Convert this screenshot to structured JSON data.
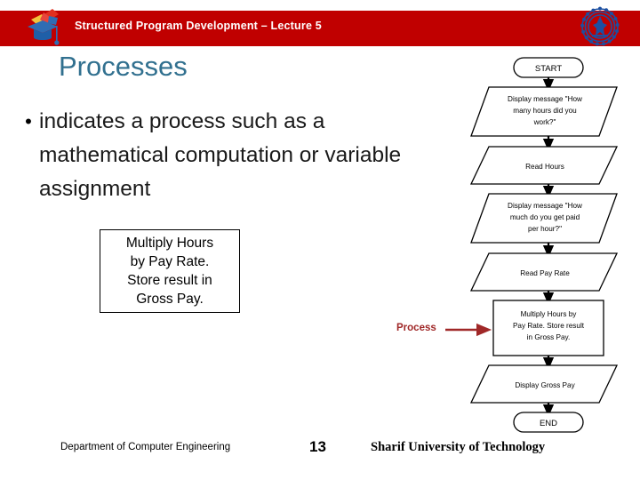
{
  "header": {
    "title": "Structured Program Development – Lecture 5",
    "bar_color": "#C00000",
    "left_logo_name": "graduation-cap-logo",
    "right_logo_name": "sharif-university-seal"
  },
  "slide": {
    "title": "Processes",
    "title_color": "#31708F",
    "bullets": [
      "indicates a process such as a mathematical computation or variable assignment"
    ],
    "example_box_text": "Multiply Hours\nby Pay Rate.\nStore result in\nGross Pay."
  },
  "callout": {
    "label": "Process",
    "color": "#A02828"
  },
  "flowchart": {
    "nodes": [
      {
        "id": "start",
        "shape": "terminator",
        "label": "START"
      },
      {
        "id": "msg_hours",
        "shape": "parallelogram",
        "label": "Display message \"How many hours did you work?\""
      },
      {
        "id": "read_hours",
        "shape": "parallelogram",
        "label": "Read Hours"
      },
      {
        "id": "msg_rate",
        "shape": "parallelogram",
        "label": "Display message \"How much do you get paid per hour?\""
      },
      {
        "id": "read_rate",
        "shape": "parallelogram",
        "label": "Read Pay Rate"
      },
      {
        "id": "multiply",
        "shape": "process",
        "label": "Multiply Hours by Pay Rate. Store result in Gross Pay."
      },
      {
        "id": "display",
        "shape": "parallelogram",
        "label": "Display Gross Pay"
      },
      {
        "id": "end",
        "shape": "terminator",
        "label": "END"
      }
    ],
    "lines": {
      "msg_hours": [
        "Display message \"How",
        "many hours did you",
        "work?\""
      ],
      "read_hours": [
        "Read Hours"
      ],
      "msg_rate": [
        "Display message \"How",
        "much do you get paid",
        "per hour?\""
      ],
      "read_rate": [
        "Read Pay Rate"
      ],
      "multiply": [
        "Multiply Hours by",
        "Pay Rate. Store result",
        "in Gross Pay."
      ],
      "display": [
        "Display Gross Pay"
      ],
      "start": [
        "START"
      ],
      "end": [
        "END"
      ]
    }
  },
  "footer": {
    "department": "Department of Computer Engineering",
    "page_number": "13",
    "university": "Sharif University of Technology"
  }
}
